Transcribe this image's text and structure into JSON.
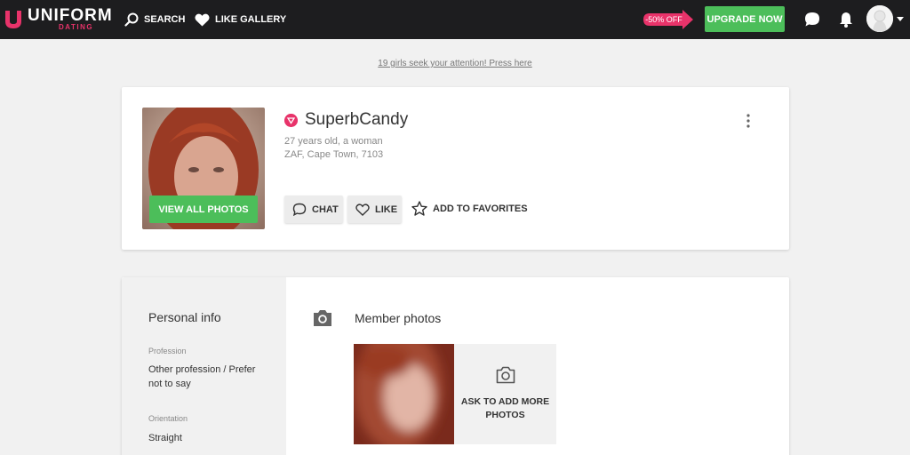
{
  "header": {
    "logo_text": "UNIFORM",
    "logo_sub": "DATING",
    "nav": {
      "search_label": "SEARCH",
      "like_gallery_label": "LIKE GALLERY"
    },
    "discount_label": "-50% OFF",
    "upgrade_label": "UPGRADE NOW"
  },
  "notice": {
    "text": "19 girls seek your attention! Press here"
  },
  "profile": {
    "username": "SuperbCandy",
    "age_gender": "27 years old, a woman",
    "location": "ZAF, Cape Town, 7103",
    "view_photos_label": "VIEW ALL PHOTOS",
    "actions": {
      "chat_label": "CHAT",
      "like_label": "LIKE",
      "favorites_label": "ADD TO FAVORITES"
    }
  },
  "personal_info": {
    "title": "Personal info",
    "profession_label": "Profession",
    "profession_value": "Other profession / Prefer not to say",
    "orientation_label": "Orientation",
    "orientation_value": "Straight"
  },
  "member_photos": {
    "title": "Member photos",
    "ask_more_label": "ASK TO ADD MORE PHOTOS"
  },
  "colors": {
    "accent": "#e8336a",
    "green": "#4cbe5a",
    "topbar": "#1d1d1f",
    "background": "#f1f1f1"
  },
  "icons": [
    "search-icon",
    "heart-icon",
    "chat-icon",
    "bell-icon",
    "avatar",
    "chevron-down-icon",
    "crown-badge-icon",
    "kebab-menu-icon",
    "star-icon",
    "camera-icon"
  ]
}
